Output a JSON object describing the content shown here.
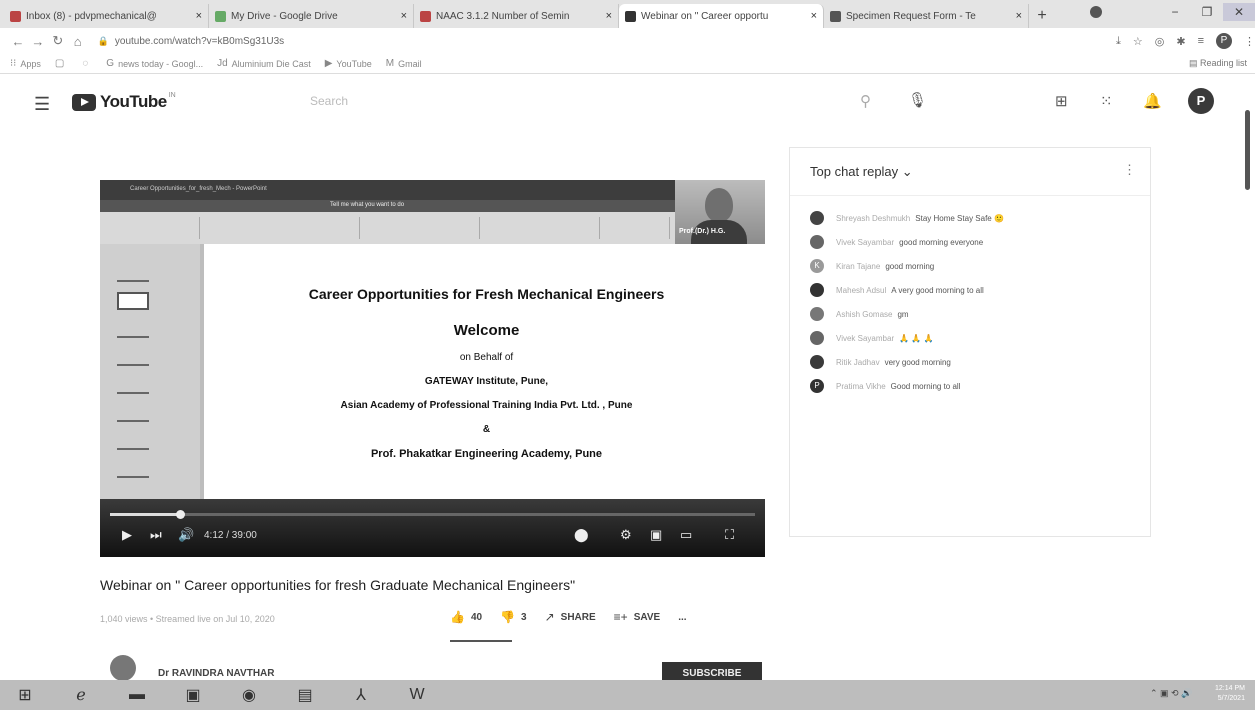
{
  "browser": {
    "tabs": [
      {
        "label": "Inbox (8) - pdvpmechanical@",
        "icon": "gmail-icon",
        "active": false
      },
      {
        "label": "My Drive - Google Drive",
        "icon": "drive-icon",
        "active": false
      },
      {
        "label": "NAAC 3.1.2 Number of Semin",
        "icon": "gmail-icon",
        "active": false
      },
      {
        "label": "Webinar on \" Career opportu",
        "icon": "youtube-icon",
        "active": true
      },
      {
        "label": "Specimen Request Form - Te",
        "icon": "forms-icon",
        "active": false
      }
    ],
    "url": "youtube.com/watch?v=kB0mSg31U3s",
    "bookmarks": [
      {
        "label": "Apps",
        "icon": "apps-icon"
      },
      {
        "label": "",
        "icon": "bookmark-icon"
      },
      {
        "label": "",
        "icon": "bookmark-icon"
      },
      {
        "label": "news today - Googl...",
        "icon": "google-icon"
      },
      {
        "label": "Aluminium Die Cast",
        "icon": "justdial-icon"
      },
      {
        "label": "YouTube",
        "icon": "youtube-icon"
      },
      {
        "label": "Gmail",
        "icon": "gmail-icon"
      }
    ],
    "reading_list": "Reading list",
    "profile_initial": "P"
  },
  "youtube": {
    "logo_text": "YouTube",
    "logo_country": "IN",
    "search_placeholder": "Search",
    "avatar_initial": "P"
  },
  "video": {
    "slide": {
      "title": "Career Opportunities for Fresh Mechanical Engineers",
      "lines": [
        "Welcome",
        "on Behalf of",
        "GATEWAY Institute, Pune,",
        "Asian Academy of Professional Training India Pvt. Ltd. , Pune",
        "&",
        "Prof. Phakatkar Engineering Academy, Pune"
      ]
    },
    "app_title": "Career Opportunities_for_fresh_Mech - PowerPoint",
    "ribbon_hint": "Tell me what you want to do",
    "webcam_caption": "Prof.(Dr.) H.G.",
    "time": "4:12 / 39:00",
    "progress": 0.108
  },
  "info": {
    "title": "Webinar on \" Career opportunities for fresh Graduate Mechanical Engineers\"",
    "meta": "1,040 views • Streamed live on Jul 10, 2020",
    "likes": "40",
    "dislikes": "3",
    "share": "SHARE",
    "save": "SAVE",
    "more": "...",
    "channel": "Dr RAVINDRA NAVTHAR",
    "subscribe": "SUBSCRIBE"
  },
  "chat": {
    "title": "Top chat replay",
    "messages": [
      {
        "author": "Shreyash Deshmukh",
        "text": "Stay Home Stay Safe 🙂",
        "avatar_color": "#444444",
        "initial": ""
      },
      {
        "author": "Vivek Sayambar",
        "text": "good morning everyone",
        "avatar_color": "#666666",
        "initial": ""
      },
      {
        "author": "Kiran Tajane",
        "text": "good morning",
        "avatar_color": "#9a9a9a",
        "initial": "K"
      },
      {
        "author": "Mahesh Adsul",
        "text": "A very good morning to all",
        "avatar_color": "#333333",
        "initial": ""
      },
      {
        "author": "Ashish Gomase",
        "text": "gm",
        "avatar_color": "#777777",
        "initial": ""
      },
      {
        "author": "Vivek Sayambar",
        "text": "🙏 🙏 🙏",
        "avatar_color": "#666666",
        "initial": ""
      },
      {
        "author": "Ritik Jadhav",
        "text": "very good morning",
        "avatar_color": "#3a3a3a",
        "initial": ""
      },
      {
        "author": "Pratima Vikhe",
        "text": "Good morning to all",
        "avatar_color": "#333333",
        "initial": "P"
      }
    ]
  },
  "taskbar": {
    "apps": [
      "windows-icon",
      "edge-icon",
      "file-explorer-icon",
      "store-icon",
      "chrome-icon",
      "notepad-icon",
      "acrobat-icon",
      "word-icon"
    ],
    "time": "12:14 PM",
    "date": "5/7/2021"
  }
}
